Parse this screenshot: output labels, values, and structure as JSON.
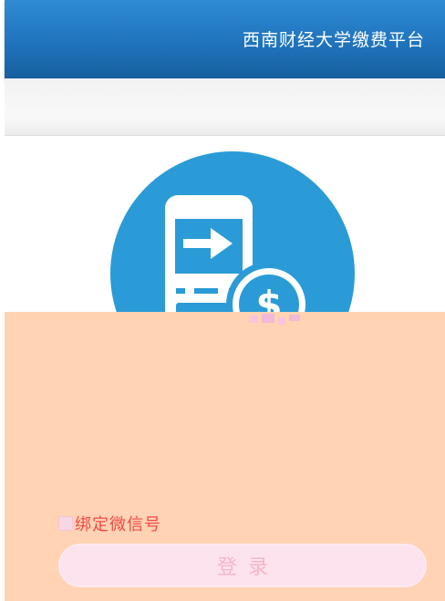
{
  "header": {
    "title": "西南财经大学缴费平台"
  },
  "logo": {
    "icon": "mobile-payment-icon",
    "circle_color": "#2a9bd6"
  },
  "form": {
    "bind_wechat_label": "绑定微信号",
    "bind_wechat_checked": false,
    "login_label": "登录"
  },
  "colors": {
    "header": "#1f74bd",
    "overlay": "#ffd3b3",
    "checkbox_label": "#f04a4a",
    "login_button": "#fde3ee"
  }
}
